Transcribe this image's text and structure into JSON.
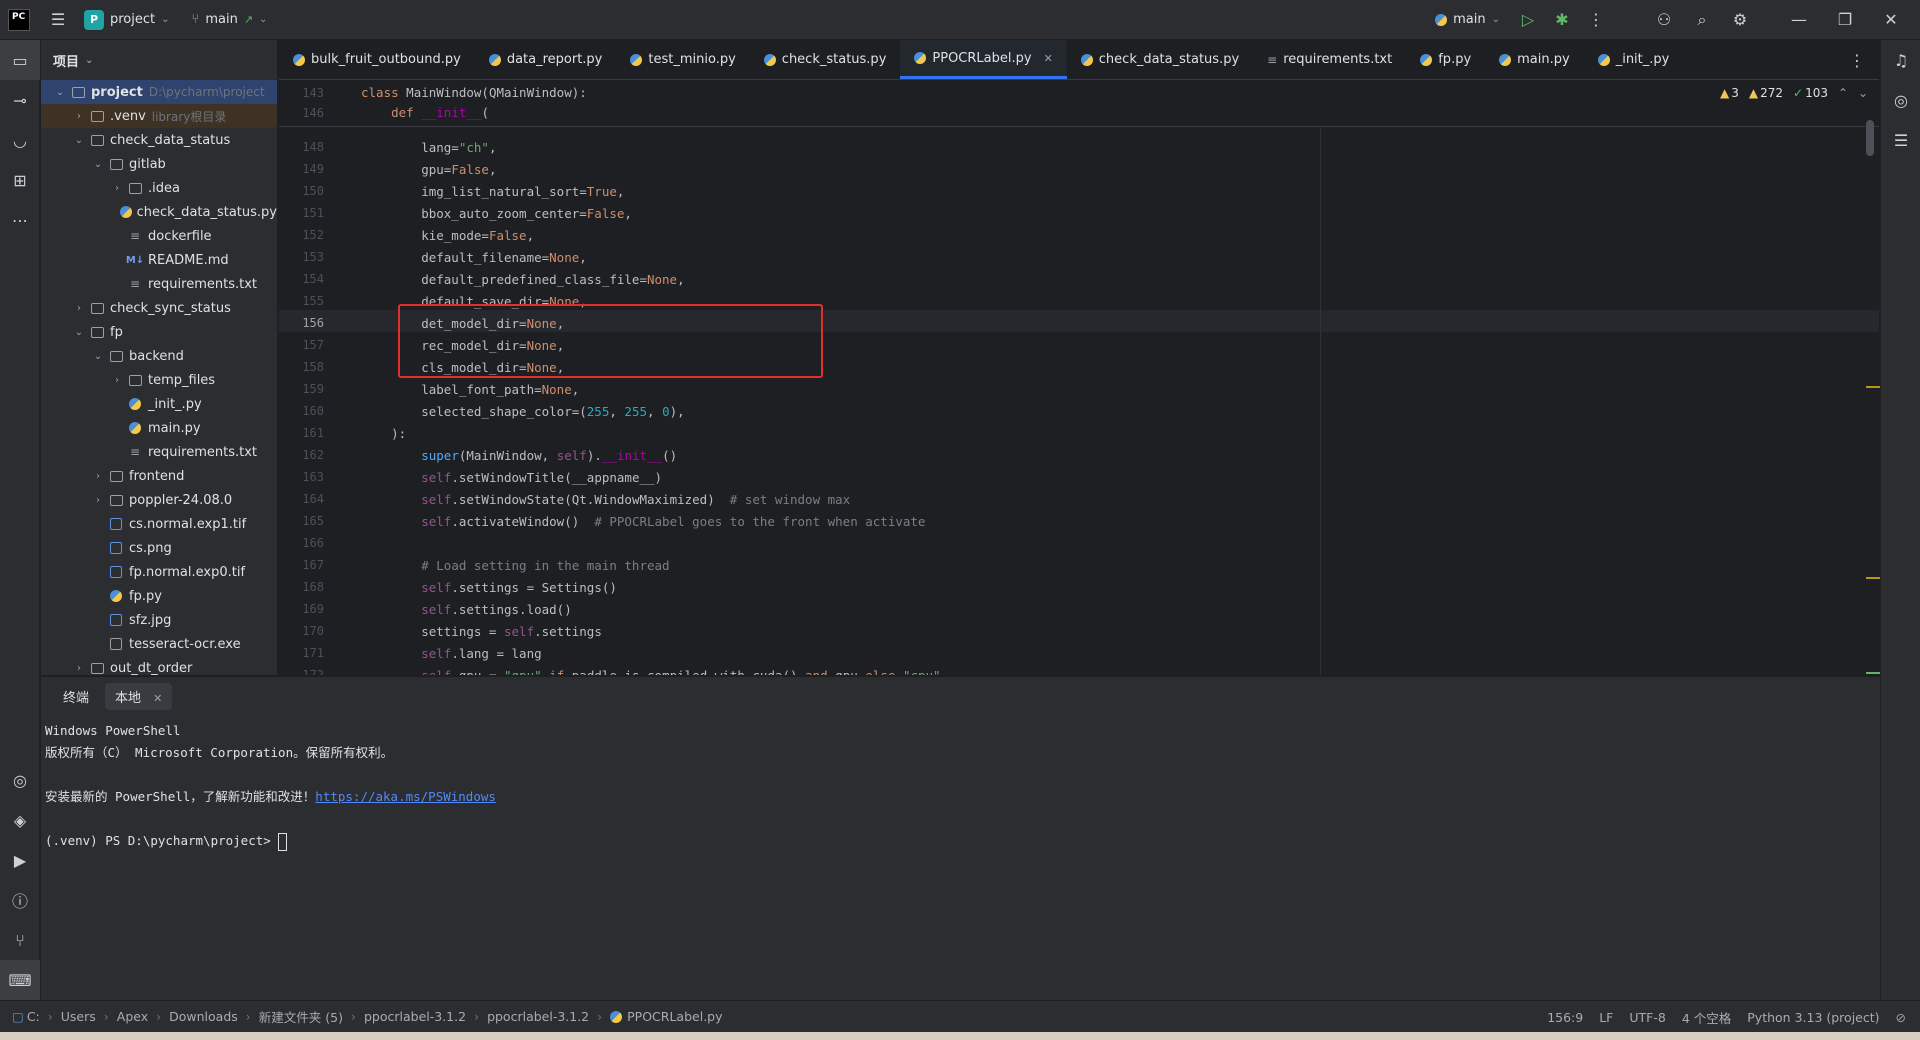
{
  "titlebar": {
    "project_name": "project",
    "branch": "main",
    "run_config": "main"
  },
  "project_panel": {
    "header": "项目",
    "tree": [
      {
        "label": "project",
        "hint": "D:\\pycharm\\project",
        "depth": 0,
        "type": "folder",
        "expanded": true,
        "selected": true
      },
      {
        "label": ".venv",
        "hint": "library根目录",
        "depth": 1,
        "type": "folder",
        "expanded": false,
        "venv": true
      },
      {
        "label": "check_data_status",
        "depth": 1,
        "type": "folder",
        "expanded": true
      },
      {
        "label": "gitlab",
        "depth": 2,
        "type": "folder",
        "expanded": true
      },
      {
        "label": ".idea",
        "depth": 3,
        "type": "folder",
        "expanded": false
      },
      {
        "label": "check_data_status.py",
        "depth": 3,
        "type": "py"
      },
      {
        "label": "dockerfile",
        "depth": 3,
        "type": "txt"
      },
      {
        "label": "README.md",
        "depth": 3,
        "type": "md"
      },
      {
        "label": "requirements.txt",
        "depth": 3,
        "type": "txt"
      },
      {
        "label": "check_sync_status",
        "depth": 1,
        "type": "folder",
        "expanded": false
      },
      {
        "label": "fp",
        "depth": 1,
        "type": "folder",
        "expanded": true
      },
      {
        "label": "backend",
        "depth": 2,
        "type": "folder",
        "expanded": true
      },
      {
        "label": "temp_files",
        "depth": 3,
        "type": "folder",
        "expanded": false
      },
      {
        "label": "_init_.py",
        "depth": 3,
        "type": "py"
      },
      {
        "label": "main.py",
        "depth": 3,
        "type": "py"
      },
      {
        "label": "requirements.txt",
        "depth": 3,
        "type": "txt"
      },
      {
        "label": "frontend",
        "depth": 2,
        "type": "folder",
        "expanded": false
      },
      {
        "label": "poppler-24.08.0",
        "depth": 2,
        "type": "folder",
        "expanded": false
      },
      {
        "label": "cs.normal.exp1.tif",
        "depth": 2,
        "type": "img"
      },
      {
        "label": "cs.png",
        "depth": 2,
        "type": "img"
      },
      {
        "label": "fp.normal.exp0.tif",
        "depth": 2,
        "type": "img"
      },
      {
        "label": "fp.py",
        "depth": 2,
        "type": "py"
      },
      {
        "label": "sfz.jpg",
        "depth": 2,
        "type": "img"
      },
      {
        "label": "tesseract-ocr.exe",
        "depth": 2,
        "type": "exe"
      },
      {
        "label": "out_dt_order",
        "depth": 1,
        "type": "folder",
        "expanded": false
      }
    ]
  },
  "tabs": [
    {
      "label": "bulk_fruit_outbound.py",
      "icon": "python-file-icon"
    },
    {
      "label": "data_report.py",
      "icon": "python-file-icon"
    },
    {
      "label": "test_minio.py",
      "icon": "python-file-icon"
    },
    {
      "label": "check_status.py",
      "icon": "python-file-icon"
    },
    {
      "label": "PPOCRLabel.py",
      "icon": "python-file-icon",
      "active": true
    },
    {
      "label": "check_data_status.py",
      "icon": "python-file-icon"
    },
    {
      "label": "requirements.txt",
      "icon": "text-file-icon"
    },
    {
      "label": "fp.py",
      "icon": "python-file-icon"
    },
    {
      "label": "main.py",
      "icon": "python-file-icon"
    },
    {
      "label": "_init_.py",
      "icon": "python-file-icon"
    }
  ],
  "editor": {
    "sticky_lines": [
      {
        "num": "143",
        "html": "<span class=\"kw\">class</span> MainWindow(QMainWindow):"
      },
      {
        "num": "146",
        "html": "    <span class=\"kw\">def</span> <span class=\"dunder\">__init__</span>("
      }
    ],
    "lines": [
      {
        "num": "148",
        "html": "        lang=<span class=\"str\">\"ch\"</span>,"
      },
      {
        "num": "149",
        "html": "        gpu=<span class=\"kw\">False</span>,"
      },
      {
        "num": "150",
        "html": "        img_list_natural_sort=<span class=\"kw\">True</span>,"
      },
      {
        "num": "151",
        "html": "        bbox_auto_zoom_center=<span class=\"kw\">False</span>,"
      },
      {
        "num": "152",
        "html": "        kie_mode=<span class=\"kw\">False</span>,"
      },
      {
        "num": "153",
        "html": "        default_filename=<span class=\"kw\">None</span>,"
      },
      {
        "num": "154",
        "html": "        default_predefined_class_file=<span class=\"kw\">None</span>,"
      },
      {
        "num": "155",
        "html": "        default_save_dir=<span class=\"kw\">None</span>,"
      },
      {
        "num": "156",
        "html": "        det_model_dir=<span class=\"kw\">None</span>,",
        "current": true
      },
      {
        "num": "157",
        "html": "        rec_model_dir=<span class=\"kw\">None</span>,"
      },
      {
        "num": "158",
        "html": "        cls_model_dir=<span class=\"kw\">None</span>,"
      },
      {
        "num": "159",
        "html": "        label_font_path=<span class=\"kw\">None</span>,"
      },
      {
        "num": "160",
        "html": "        selected_shape_color=(<span class=\"num\">255</span>, <span class=\"num\">255</span>, <span class=\"num\">0</span>),"
      },
      {
        "num": "161",
        "html": "    ):"
      },
      {
        "num": "162",
        "html": "        <span class=\"fn\">super</span>(MainWindow, <span class=\"self\">self</span>).<span class=\"dunder\">__init__</span>()"
      },
      {
        "num": "163",
        "html": "        <span class=\"self\">self</span>.setWindowTitle(__appname__)"
      },
      {
        "num": "164",
        "html": "        <span class=\"self\">self</span>.setWindowState(Qt.WindowMaximized)  <span class=\"cmt\"># set window max</span>"
      },
      {
        "num": "165",
        "html": "        <span class=\"self\">self</span>.activateWindow()  <span class=\"cmt\"># PPOCRLabel goes to the front when activate</span>"
      },
      {
        "num": "166",
        "html": ""
      },
      {
        "num": "167",
        "html": "        <span class=\"cmt\"># Load setting in the main thread</span>"
      },
      {
        "num": "168",
        "html": "        <span class=\"self\">self</span>.settings = Settings()"
      },
      {
        "num": "169",
        "html": "        <span class=\"self\">self</span>.settings.load()"
      },
      {
        "num": "170",
        "html": "        settings = <span class=\"self\">self</span>.settings"
      },
      {
        "num": "171",
        "html": "        <span class=\"self\">self</span>.lang = lang"
      },
      {
        "num": "172",
        "html": "        <span class=\"self\">self</span>.gpu = <span class=\"str\">\"gpu\"</span> <span class=\"kw\">if</span> paddle.is_compiled_with_cuda() <span class=\"kw\">and</span> gpu <span class=\"kw\">else</span> <span class=\"str\">\"cpu\"</span>"
      }
    ],
    "indicators": {
      "errors": "3",
      "warnings": "272",
      "ok": "103"
    }
  },
  "terminal": {
    "tab_label": "终端",
    "session_label": "本地",
    "lines": [
      "Windows PowerShell",
      "版权所有（C） Microsoft Corporation。保留所有权利。",
      "",
      "安装最新的 PowerShell，了解新功能和改进！",
      "",
      "(.venv) PS D:\\pycharm\\project>"
    ],
    "link": "https://aka.ms/PSWindows"
  },
  "statusbar": {
    "breadcrumbs": [
      "C:",
      "Users",
      "Apex",
      "Downloads",
      "新建文件夹 (5)",
      "ppocrlabel-3.1.2",
      "ppocrlabel-3.1.2",
      "PPOCRLabel.py"
    ],
    "position": "156:9",
    "line_ending": "LF",
    "encoding": "UTF-8",
    "indent": "4 个空格",
    "interpreter": "Python 3.13 (project)"
  }
}
